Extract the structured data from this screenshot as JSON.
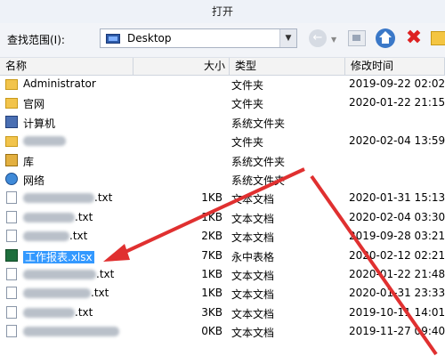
{
  "window": {
    "title": "打开"
  },
  "toolbar": {
    "look_in_label": "查找范围(I):",
    "look_in_value": "Desktop",
    "icons": [
      "back-icon",
      "up-folder-icon",
      "home-icon",
      "delete-icon",
      "new-folder-icon"
    ]
  },
  "columns": {
    "name": "名称",
    "size": "大小",
    "type": "类型",
    "date": "修改时间"
  },
  "files": [
    {
      "name": "Administrator",
      "size": "",
      "type": "文件夹",
      "date": "2019-09-22 02:02",
      "icon": "folder-icon"
    },
    {
      "name": "官网",
      "size": "",
      "type": "文件夹",
      "date": "2020-01-22 21:15",
      "icon": "folder-icon"
    },
    {
      "name": "计算机",
      "size": "",
      "type": "系统文件夹",
      "date": "",
      "icon": "computer-icon"
    },
    {
      "name": "",
      "size": "",
      "type": "文件夹",
      "date": "2020-02-04 13:59",
      "icon": "folder-icon"
    },
    {
      "name": "库",
      "size": "",
      "type": "系统文件夹",
      "date": "",
      "icon": "library-icon"
    },
    {
      "name": "网络",
      "size": "",
      "type": "系统文件夹",
      "date": "",
      "icon": "network-icon"
    },
    {
      "name": ".txt",
      "size": "1KB",
      "type": "文本文档",
      "date": "2020-01-31 15:13",
      "icon": "file-icon"
    },
    {
      "name": ".txt",
      "size": "1KB",
      "type": "文本文档",
      "date": "2020-02-04 03:30",
      "icon": "file-icon"
    },
    {
      "name": ".txt",
      "size": "2KB",
      "type": "文本文档",
      "date": "2019-09-28 03:21",
      "icon": "file-icon"
    },
    {
      "name": "工作报表.xlsx",
      "size": "7KB",
      "type": "永中表格",
      "date": "2020-02-12 02:21",
      "icon": "excel-icon"
    },
    {
      "name": ".txt",
      "size": "1KB",
      "type": "文本文档",
      "date": "2020-01-22 21:48",
      "icon": "file-icon"
    },
    {
      "name": ".txt",
      "size": "1KB",
      "type": "文本文档",
      "date": "2020-01-31 23:33",
      "icon": "file-icon"
    },
    {
      "name": ".txt",
      "size": "3KB",
      "type": "文本文档",
      "date": "2019-10-11 14:01",
      "icon": "file-icon"
    },
    {
      "name": "",
      "size": "0KB",
      "type": "文本文档",
      "date": "2019-11-27 09:40",
      "icon": "file-icon"
    }
  ],
  "colors": {
    "selection": "#3399ff",
    "arrow": "#e03030"
  }
}
